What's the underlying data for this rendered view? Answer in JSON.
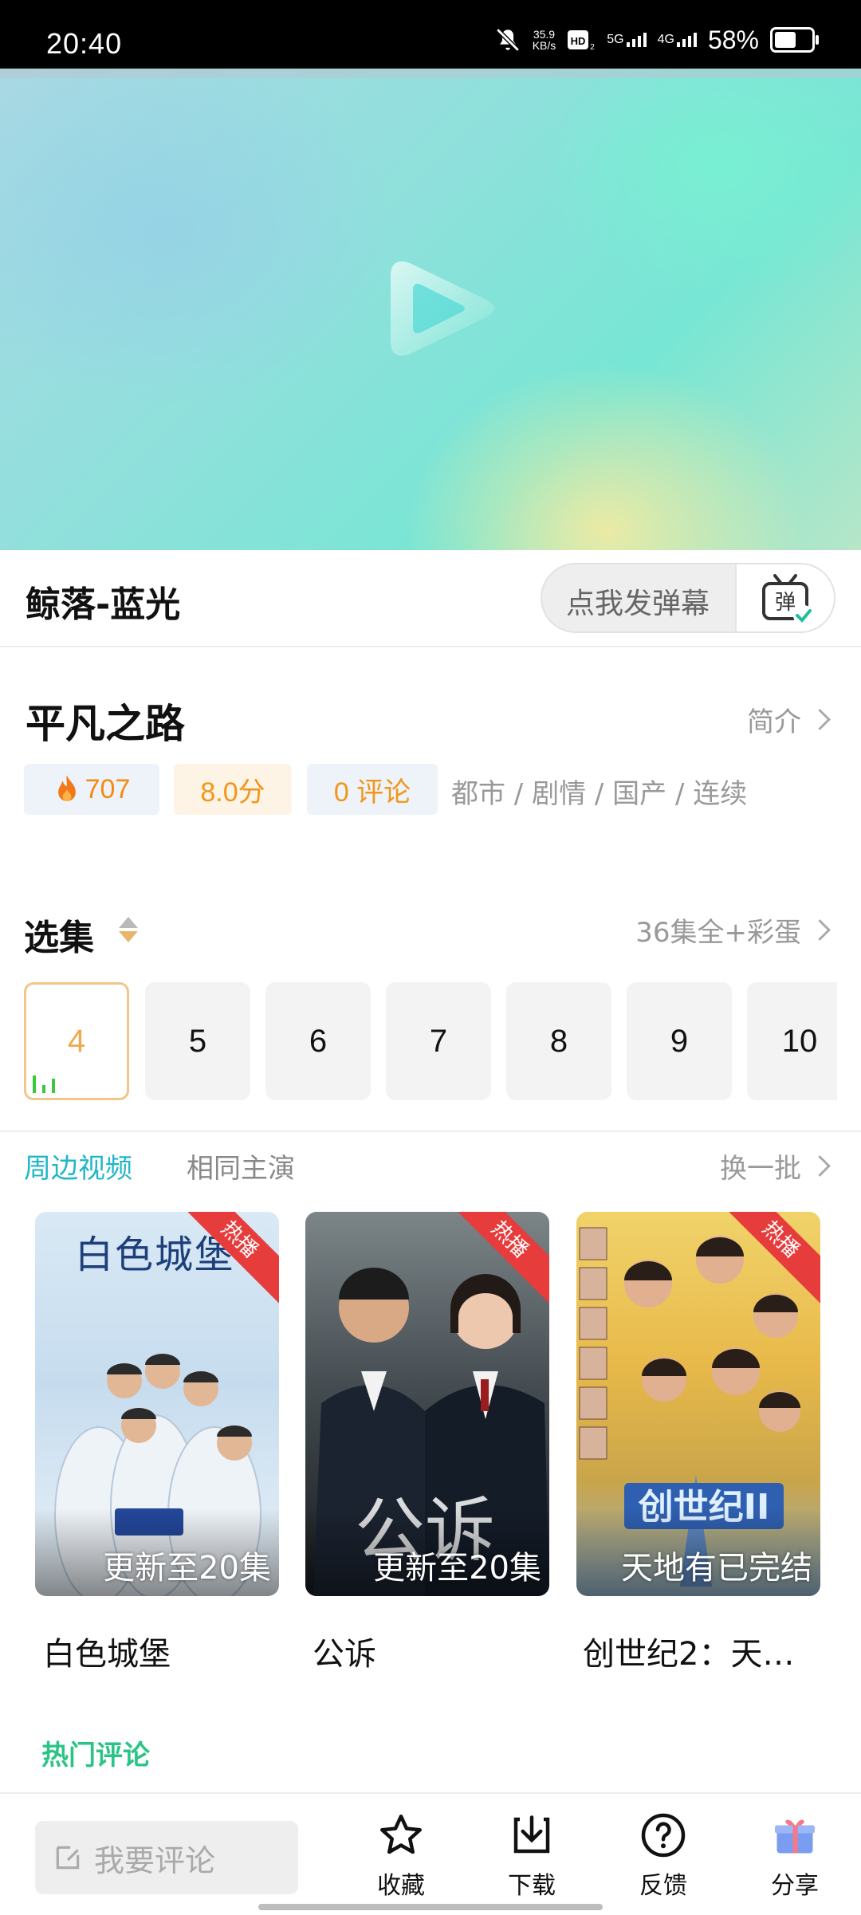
{
  "status_bar": {
    "time": "20:40",
    "net_speed_value": "35.9",
    "net_speed_unit": "KB/s",
    "sim1": "5G",
    "sim2": "4G",
    "battery": "58%"
  },
  "player": {
    "source_title": "鲸落-蓝光",
    "danmu_placeholder": "点我发弹幕",
    "danmu_icon_char": "弹"
  },
  "show": {
    "title": "平凡之路",
    "intro_label": "简介",
    "hot": "707",
    "score": "8.0分",
    "comments": "0 评论",
    "genres": "都市 / 剧情 / 国产 / 连续"
  },
  "episodes": {
    "title": "选集",
    "count_label": "36集全+彩蛋",
    "items": [
      "4",
      "5",
      "6",
      "7",
      "8",
      "9",
      "10"
    ],
    "active": "4"
  },
  "related": {
    "tabs": [
      "周边视频",
      "相同主演"
    ],
    "active_tab": "周边视频",
    "refresh_label": "换一批",
    "badge": "热播",
    "cards": [
      {
        "name": "白色城堡",
        "update": "更新至20集",
        "poster_text": "白色城堡"
      },
      {
        "name": "公诉",
        "update": "更新至20集",
        "poster_text": "公诉"
      },
      {
        "name": "创世纪2：天…",
        "update": "天地有已完结",
        "poster_text": "创世纪II"
      }
    ]
  },
  "hot_comments_label": "热门评论",
  "bottom_bar": {
    "comment_placeholder": "我要评论",
    "actions": [
      {
        "label": "收藏",
        "icon": "star-icon"
      },
      {
        "label": "下载",
        "icon": "download-icon"
      },
      {
        "label": "反馈",
        "icon": "help-icon"
      },
      {
        "label": "分享",
        "icon": "gift-icon"
      }
    ]
  },
  "colors": {
    "accent_teal": "#22b6c8",
    "accent_orange": "#f2961a",
    "accent_green": "#2bc486",
    "badge_red": "#e63c3c"
  }
}
